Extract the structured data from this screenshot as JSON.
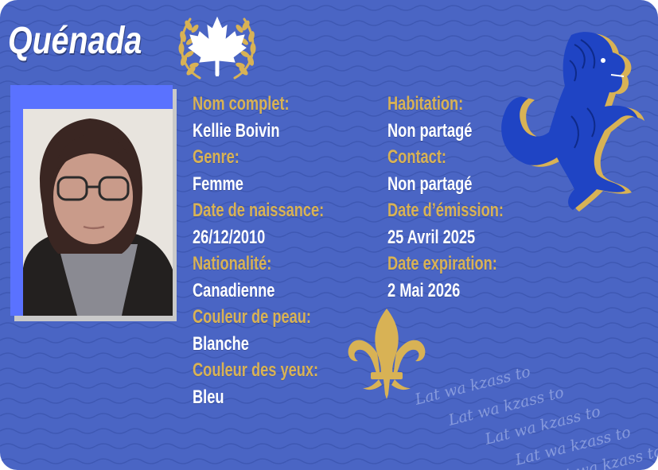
{
  "card": {
    "brand": "Quénada",
    "colors": {
      "background": "#4a65c4",
      "label": "#d8b255",
      "value": "#ffffff",
      "photo_bg": "#5a72ff"
    },
    "icons": [
      "maple-leaf-laurel-emblem",
      "rampant-lion-icon",
      "fleur-de-lis-icon"
    ]
  },
  "fields_left": [
    {
      "label": "Nom complet:",
      "value": "Kellie Boivin"
    },
    {
      "label": "Genre:",
      "value": "Femme"
    },
    {
      "label": "Date de naissance:",
      "value": "26/12/2010"
    },
    {
      "label": "Nationalité:",
      "value": "Canadienne"
    },
    {
      "label": "Couleur de peau:",
      "value": "Blanche"
    },
    {
      "label": "Couleur des yeux:",
      "value": "Bleu"
    }
  ],
  "fields_right": [
    {
      "label": "Habitation:",
      "value": "Non partagé"
    },
    {
      "label": "Contact:",
      "value": "Non partagé"
    },
    {
      "label": "Date d’émission:",
      "value": "25 Avril 2025"
    },
    {
      "label": "Date expiration:",
      "value": "2 Mai 2026"
    }
  ],
  "watermark": {
    "lines": [
      "Lat wa kzass to",
      "Lat wa kzass to",
      "Lat wa kzass to",
      "Lat wa kzass to",
      "Lat wa kzass to"
    ]
  }
}
